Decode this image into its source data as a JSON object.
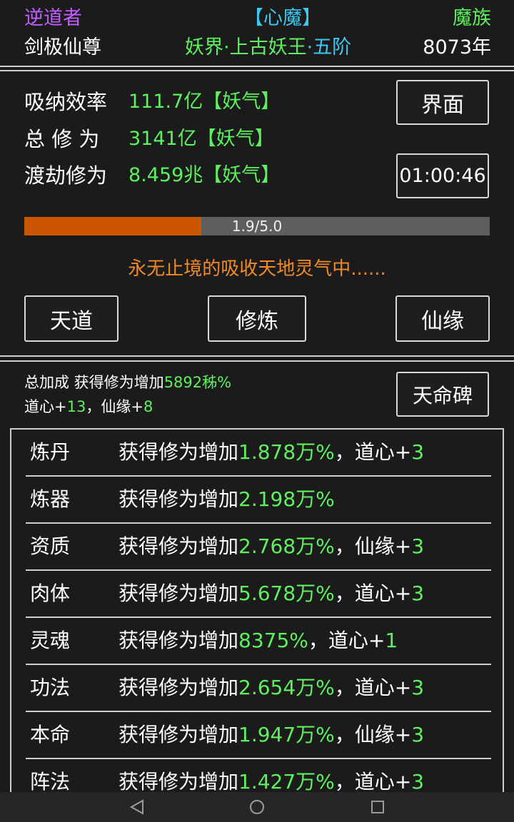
{
  "header": {
    "left_title": "逆道者",
    "left_sub": "剑极仙尊",
    "center_title": "【心魔】",
    "center_sub_a": "妖界",
    "center_sub_dot1": "·",
    "center_sub_b": "上古妖王",
    "center_sub_dot2": "·",
    "center_sub_c": "五阶",
    "right_title": "魔族",
    "right_sub": "8073年"
  },
  "stats": {
    "rate_label": "吸纳效率",
    "rate_value": "111.7亿【妖气】",
    "total_label": "总 修 为",
    "total_value": "3141亿【妖气】",
    "tribulation_label": "渡劫修为",
    "tribulation_value": "8.459兆【妖气】"
  },
  "buttons": {
    "interface": "界面",
    "timer": "01:00:46",
    "tiandao": "天道",
    "cultivate": "修炼",
    "xianyuan": "仙缘",
    "tianming": "天命碑"
  },
  "progress": {
    "text": "1.9/5.0",
    "fraction": 0.38
  },
  "status_message": "永无止境的吸收天地灵气中......",
  "bonus": {
    "line1_prefix": "总加成 获得修为增加",
    "line1_value": "5892秭%",
    "line2_a": "道心+",
    "line2_a_val": "13",
    "line2_sep": "，仙缘+",
    "line2_b_val": "8"
  },
  "list": [
    {
      "name": "炼丹",
      "prefix": "获得修为增加",
      "value": "1.878万%",
      "extra": "，道心+",
      "extra_val": "3"
    },
    {
      "name": "炼器",
      "prefix": "获得修为增加",
      "value": "2.198万%",
      "extra": "",
      "extra_val": ""
    },
    {
      "name": "资质",
      "prefix": "获得修为增加",
      "value": "2.768万%",
      "extra": "，仙缘+",
      "extra_val": "3"
    },
    {
      "name": "肉体",
      "prefix": "获得修为增加",
      "value": "5.678万%",
      "extra": "，道心+",
      "extra_val": "3"
    },
    {
      "name": "灵魂",
      "prefix": "获得修为增加",
      "value": "8375%",
      "extra": "，道心+",
      "extra_val": "1"
    },
    {
      "name": "功法",
      "prefix": "获得修为增加",
      "value": "2.654万%",
      "extra": "，道心+",
      "extra_val": "3"
    },
    {
      "name": "本命",
      "prefix": "获得修为增加",
      "value": "1.947万%",
      "extra": "，仙缘+",
      "extra_val": "3"
    },
    {
      "name": "阵法",
      "prefix": "获得修为增加",
      "value": "1.427万%",
      "extra": "，道心+",
      "extra_val": "3"
    }
  ],
  "colors": {
    "purple": "#c45cff",
    "green": "#5ef05e",
    "cyan": "#3cc8f0",
    "orange": "#f08a28",
    "progress_fill": "#cc5500",
    "progress_track": "#5e5e5e"
  },
  "navbar": {
    "back_icon": "back-triangle-icon",
    "home_icon": "home-circle-icon",
    "recents_icon": "recents-square-icon"
  }
}
